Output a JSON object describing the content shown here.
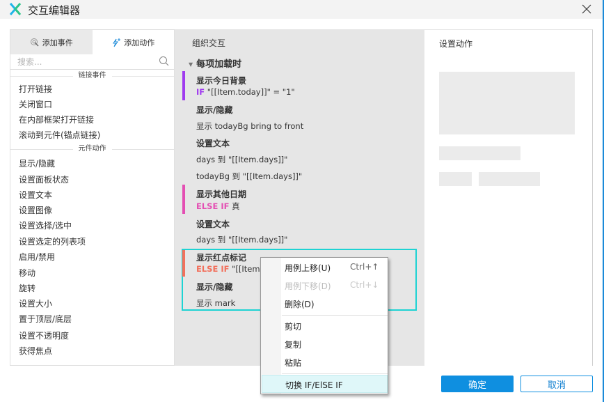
{
  "window": {
    "title": "交互编辑器",
    "logo_icon": "axure-x-logo",
    "close_icon": "close-icon"
  },
  "left": {
    "tabs": [
      {
        "label": "添加事件",
        "icon": "cursor-click-icon",
        "active": false
      },
      {
        "label": "添加动作",
        "icon": "lightning-plus-icon",
        "active": true
      }
    ],
    "search": {
      "placeholder": "搜索...",
      "value": ""
    },
    "sections": [
      {
        "header": "链接事件",
        "items": [
          "打开链接",
          "关闭窗口",
          "在内部框架打开链接",
          "滚动到元件(锚点链接)"
        ]
      },
      {
        "header": "元件动作",
        "items": [
          "显示/隐藏",
          "设置面板状态",
          "设置文本",
          "设置图像",
          "设置选择/选中",
          "设置选定的列表项",
          "启用/禁用",
          "移动",
          "旋转",
          "设置大小",
          "置于顶层/底层",
          "设置不透明度",
          "获得焦点"
        ]
      }
    ]
  },
  "middle": {
    "header": "组织交互",
    "event": "每项加载时",
    "cases": [
      {
        "name": "显示今日背景",
        "condition_kw": "IF",
        "condition": " \"[[Item.today]]\" = \"1\"",
        "color": "#a03bef",
        "actions": [
          {
            "title": "显示/隐藏",
            "lines": [
              "显示 todayBg  bring to front"
            ]
          },
          {
            "title": "设置文本",
            "lines": [
              "days 到 \"[[Item.days]]\"",
              "todayBg 到 \"[[Item.days]]\""
            ]
          }
        ]
      },
      {
        "name": "显示其他日期",
        "condition_kw": "ELSE IF",
        "condition": " 真",
        "color": "#e44fb3",
        "actions": [
          {
            "title": "设置文本",
            "lines": [
              "days 到 \"[[Item.days]]\""
            ]
          }
        ]
      },
      {
        "name": "显示红点标记",
        "condition_kw": "ELSE IF",
        "condition": " \"[[Item.m",
        "color": "#f2705c",
        "selected": true,
        "actions": [
          {
            "title": "显示/隐藏",
            "lines": [
              "显示 mark"
            ]
          }
        ]
      }
    ]
  },
  "right": {
    "header": "设置动作"
  },
  "context_menu": {
    "items": [
      {
        "label": "用例上移(U)",
        "shortcut": "Ctrl+↑",
        "enabled": true
      },
      {
        "label": "用例下移(D)",
        "shortcut": "Ctrl+↓",
        "enabled": false
      },
      {
        "label": "删除(D)",
        "shortcut": "",
        "enabled": true
      },
      {
        "label": "剪切",
        "shortcut": "",
        "enabled": true
      },
      {
        "label": "复制",
        "shortcut": "",
        "enabled": true
      },
      {
        "label": "粘贴",
        "shortcut": "",
        "enabled": true
      },
      {
        "label": "切换 IF/ElSE IF",
        "shortcut": "",
        "enabled": true,
        "highlighted": true
      }
    ]
  },
  "footer": {
    "ok_label": "确定",
    "cancel_label": "取消"
  },
  "colors": {
    "accent": "#0f8fe0",
    "selection": "#1ed3d3"
  }
}
